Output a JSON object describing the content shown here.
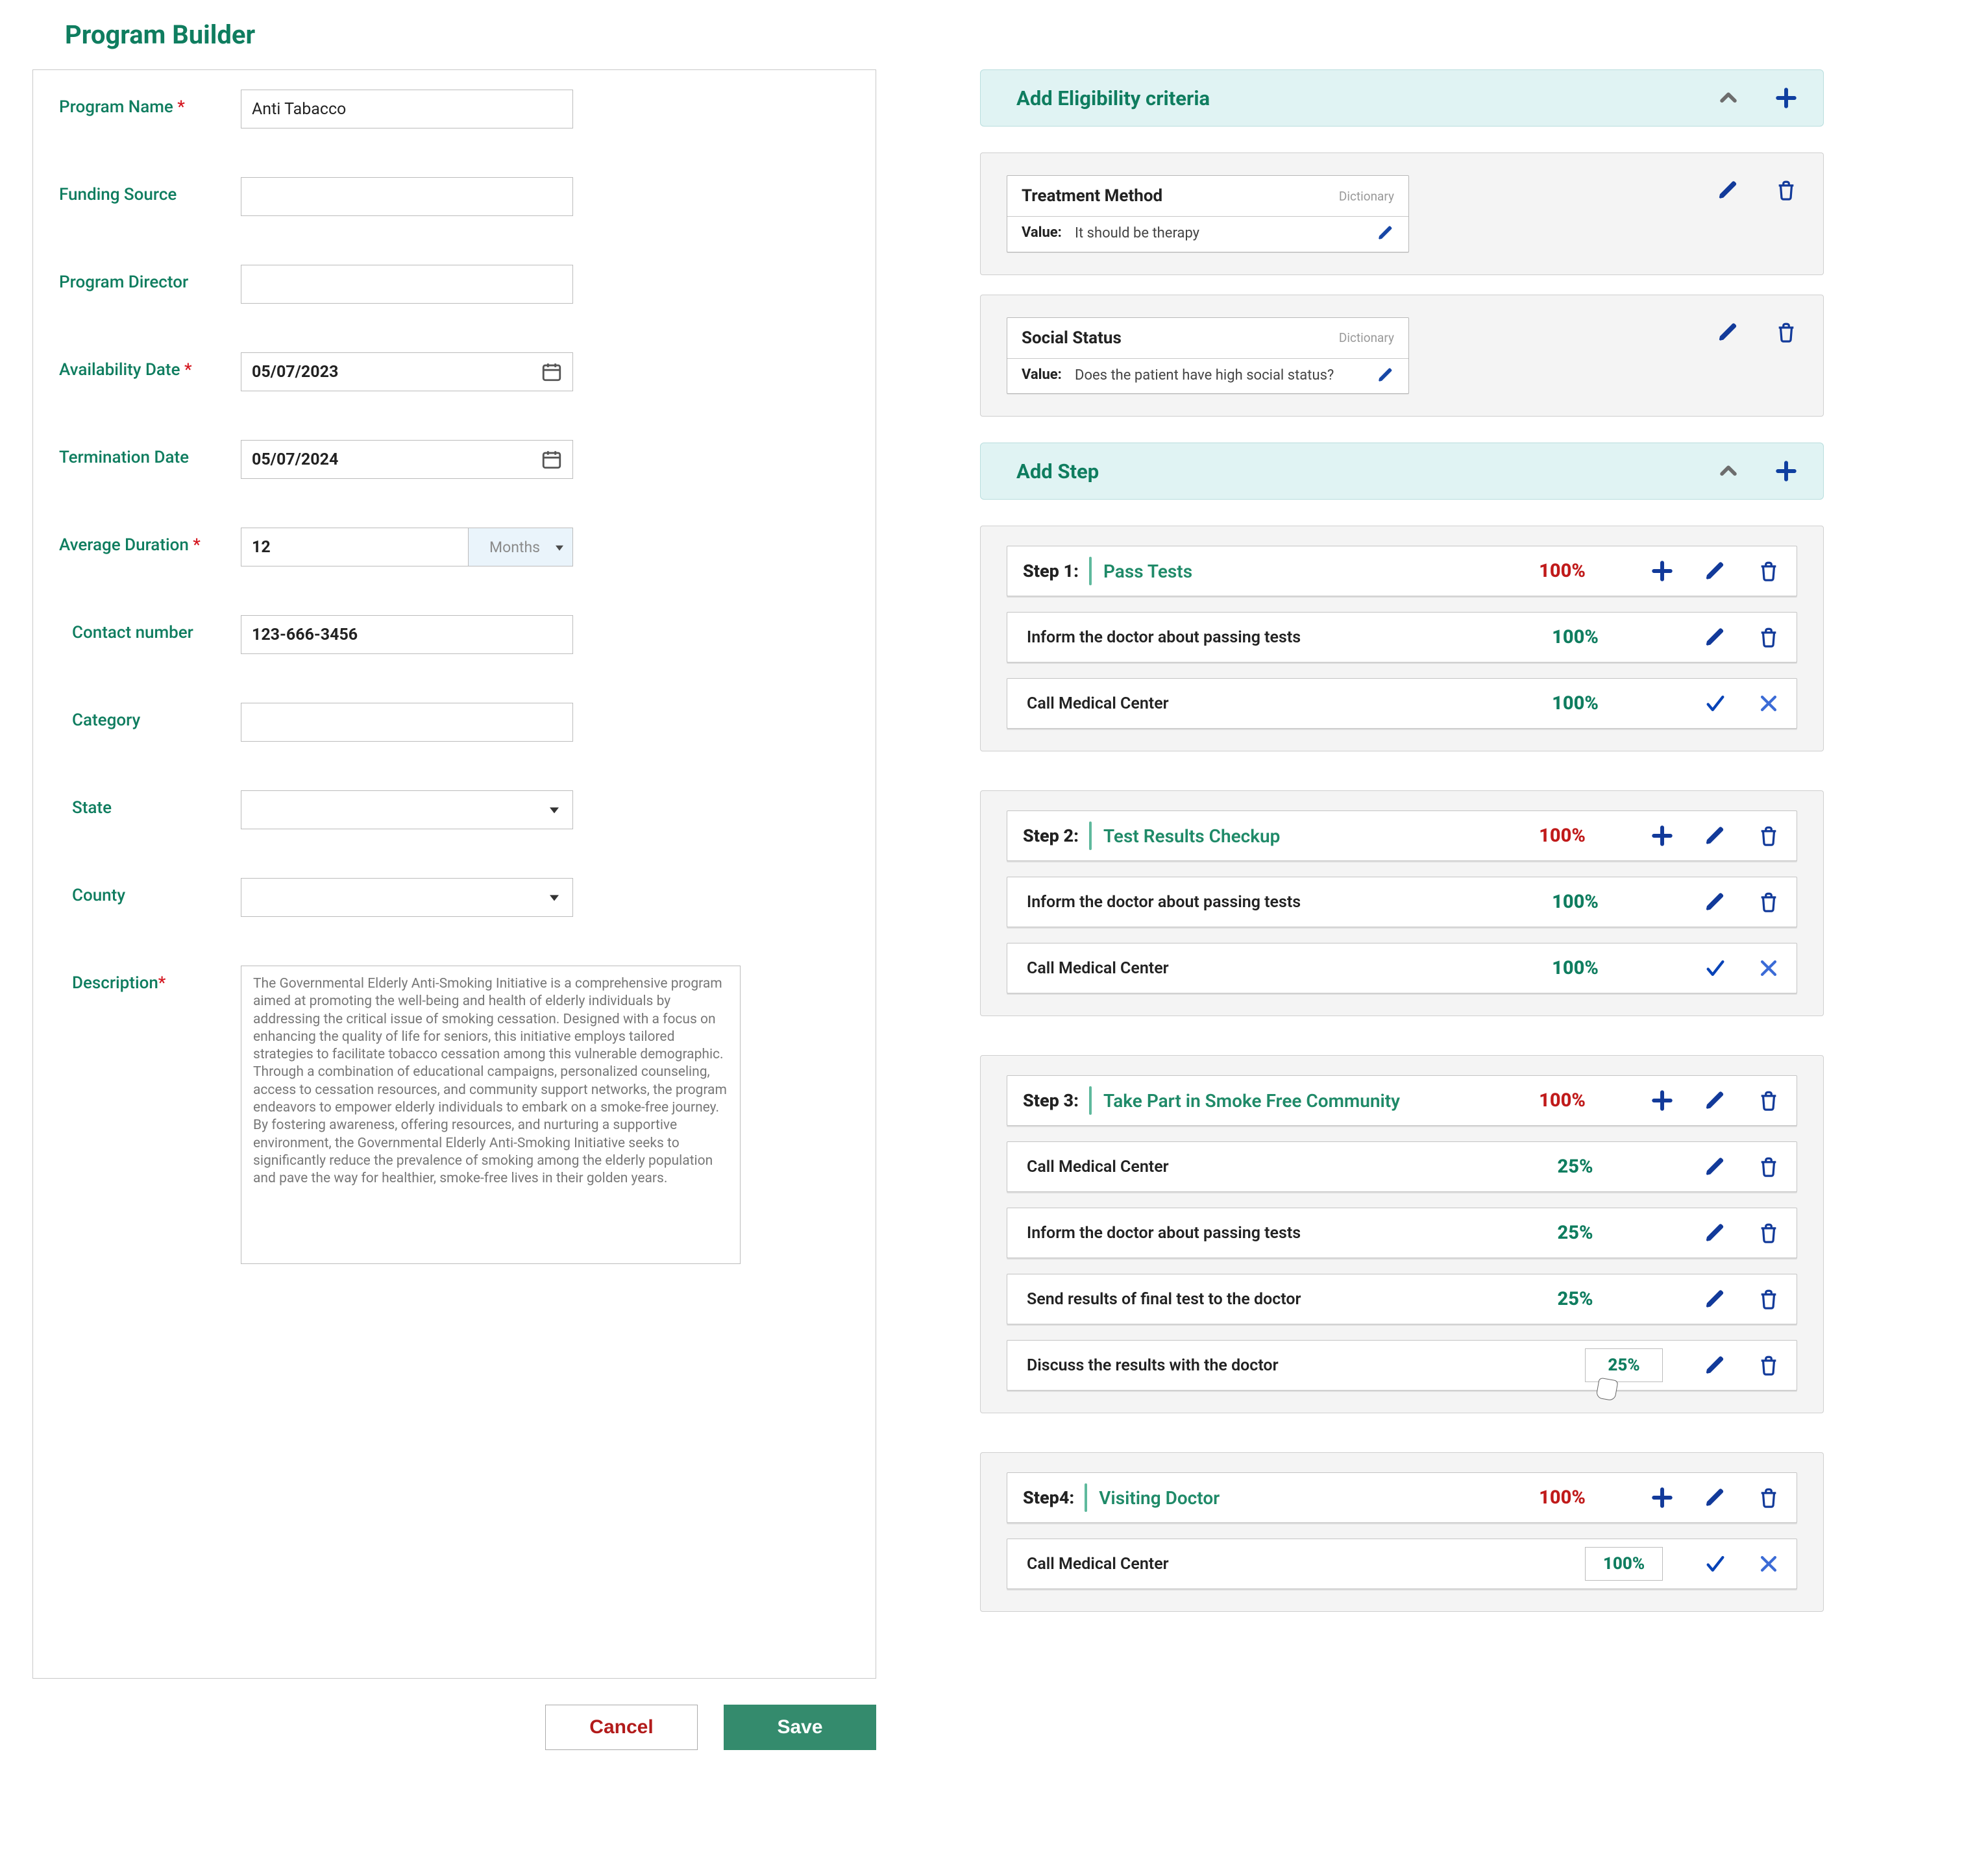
{
  "title": "Program Builder",
  "form": {
    "labels": {
      "program_name": "Program Name",
      "funding_source": "Funding Source",
      "program_director": "Program Director",
      "availability_date": "Availability Date",
      "termination_date": "Termination Date",
      "avg_duration": "Average  Duration",
      "contact_number": "Contact number",
      "category": "Category",
      "state": "State",
      "county": "County",
      "description": "Description"
    },
    "required_mark": " *",
    "values": {
      "program_name": "Anti Tabacco",
      "funding_source": "",
      "program_director": "",
      "availability_date": "05/07/2023",
      "termination_date": "05/07/2024",
      "avg_duration_num": "12",
      "avg_duration_unit": "Months",
      "contact_number": "123-666-3456",
      "category": "",
      "state": "",
      "county": "",
      "description": "The Governmental Elderly Anti-Smoking Initiative is a comprehensive program aimed at promoting the well-being and health of elderly individuals by addressing the critical issue of smoking cessation. Designed with a focus on enhancing the quality of life for seniors, this initiative employs tailored strategies to facilitate tobacco cessation among this vulnerable demographic. Through a combination of educational campaigns, personalized counseling, access to cessation resources, and community support networks, the program endeavors to empower elderly individuals to embark on a smoke-free journey. By fostering awareness, offering resources, and nurturing a supportive environment, the Governmental Elderly Anti-Smoking Initiative seeks to significantly reduce the prevalence of smoking among the elderly population and pave the way for healthier, smoke-free lives in their golden years."
    },
    "buttons": {
      "cancel": "Cancel",
      "save": "Save"
    }
  },
  "eligibility": {
    "header": "Add Eligibility  criteria",
    "items": [
      {
        "title": "Treatment Method",
        "tag": "Dictionary",
        "value_key": "Value:",
        "value": "It should be therapy"
      },
      {
        "title": "Social Status",
        "tag": "Dictionary",
        "value_key": "Value:",
        "value": "Does the patient have high social status?"
      }
    ]
  },
  "steps_header": "Add Step",
  "steps": [
    {
      "label": "Step 1:",
      "name": "Pass Tests",
      "pct": "100%",
      "subs": [
        {
          "name": "Inform the doctor about passing tests",
          "pct": "100%",
          "mode": "edit"
        },
        {
          "name": "Call Medical Center",
          "pct": "100%",
          "mode": "confirm"
        }
      ]
    },
    {
      "label": "Step 2:",
      "name": "Test Results Checkup",
      "pct": "100%",
      "subs": [
        {
          "name": "Inform the doctor about passing tests",
          "pct": "100%",
          "mode": "edit"
        },
        {
          "name": "Call Medical Center",
          "pct": "100%",
          "mode": "confirm"
        }
      ]
    },
    {
      "label": "Step 3:",
      "name": "Take Part in Smoke Free Community",
      "pct": "100%",
      "subs": [
        {
          "name": "Call Medical Center",
          "pct": "25%",
          "mode": "edit"
        },
        {
          "name": "Inform the doctor about passing tests",
          "pct": "25%",
          "mode": "edit"
        },
        {
          "name": "Send results of final test to the doctor",
          "pct": "25%",
          "mode": "edit"
        },
        {
          "name": "Discuss the results with the doctor",
          "pct": "25%",
          "mode": "edit_box"
        }
      ]
    },
    {
      "label": "Step4:",
      "name": "Visiting Doctor",
      "pct": "100%",
      "subs": [
        {
          "name": "Call Medical Center",
          "pct": "100%",
          "mode": "confirm_box"
        }
      ]
    }
  ]
}
